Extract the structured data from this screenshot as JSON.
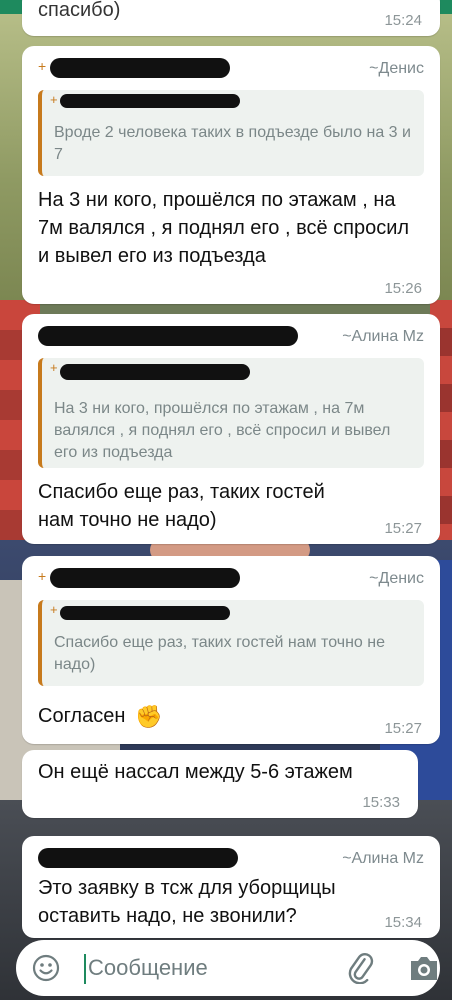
{
  "messages": [
    {
      "sender_name": "",
      "text": "спасибо)",
      "time": "15:24"
    },
    {
      "sender_name": "~Денис",
      "quote_text": "Вроде 2 человека таких в подъезде было на 3 и 7",
      "text": "На 3 ни кого, прошёлся по этажам , на 7м валялся , я поднял его , всё спросил и вывел его из подъезда",
      "time": "15:26"
    },
    {
      "sender_name": "~Алина Mz",
      "quote_text": "На 3 ни кого, прошёлся по этажам , на 7м валялся , я поднял его , всё спросил и вывел его из подъезда",
      "text": "Спасибо еще раз, таких гостей нам точно не надо)",
      "time": "15:27"
    },
    {
      "sender_name": "~Денис",
      "quote_text": "Спасибо еще раз, таких гостей нам точно не надо)",
      "text": "Согласен",
      "emoji": "✊",
      "time": "15:27"
    },
    {
      "text": "Он ещё нассал между 5-6 этажем",
      "time": "15:33"
    },
    {
      "sender_name": "~Алина Mz",
      "text": "Это заявку в тсж для уборщицы оставить надо, не звонили?",
      "time": "15:34"
    }
  ],
  "input": {
    "placeholder": "Сообщение",
    "icons": [
      "emoji-icon",
      "attach-icon",
      "camera-icon"
    ]
  },
  "colors": {
    "accent": "#1e8a5e",
    "quote_bar": "#c77a1c",
    "bubble": "#ffffff",
    "meta_text": "#8d9698"
  }
}
